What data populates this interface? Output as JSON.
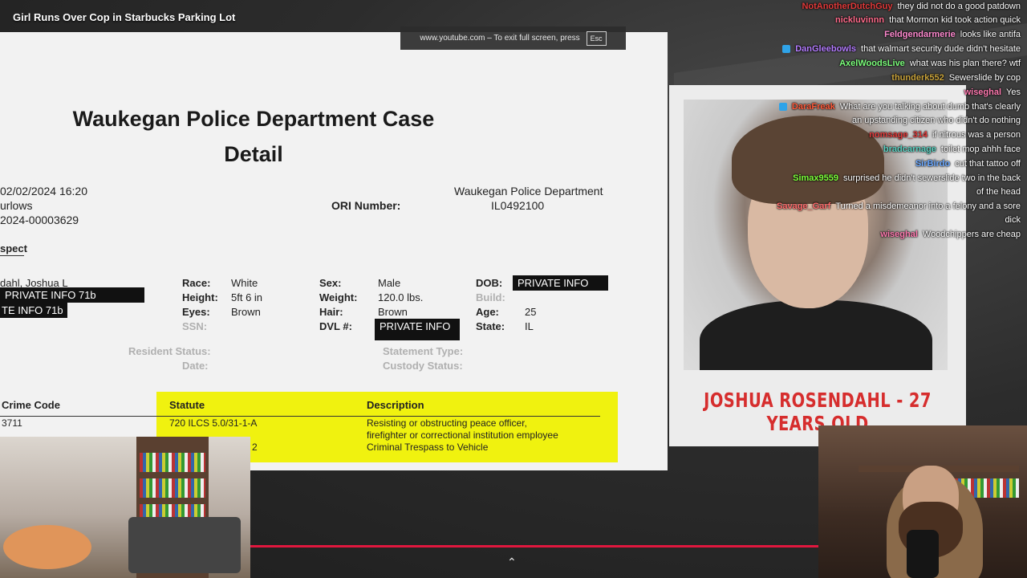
{
  "video": {
    "title": "Girl Runs Over Cop in Starbucks Parking Lot",
    "fullscreen_hint": "www.youtube.com – To exit full screen, press",
    "esc_key": "Esc",
    "progress_fraction": 1.0,
    "accent_color": "#e0173e"
  },
  "document": {
    "title_line1": "Waukegan Police Department Case",
    "title_line2": "Detail",
    "datetime": "02/02/2024 16:20",
    "officer": "urlows",
    "case_no": "2024-00003629",
    "ori_label": "ORI Number:",
    "dept_name": "Waukegan Police Department",
    "ori_number": "IL0492100",
    "section": "spect",
    "name": "dahl, Joshua L",
    "redact1": "PRIVATE INFO 71b",
    "redact2": "TE INFO 71b",
    "race_label": "Race:",
    "race": "White",
    "height_label": "Height:",
    "height": "5ft 6 in",
    "eyes_label": "Eyes:",
    "eyes": "Brown",
    "ssn_label": "SSN:",
    "sex_label": "Sex:",
    "sex": "Male",
    "weight_label": "Weight:",
    "weight": "120.0 lbs.",
    "hair_label": "Hair:",
    "hair": "Brown",
    "dvl_label": "DVL #:",
    "dvl": "PRIVATE INFO",
    "dob_label": "DOB:",
    "dob": "PRIVATE INFO",
    "build_label": "Build:",
    "age_label": "Age:",
    "age": "25",
    "state_label": "State:",
    "state": "IL",
    "resident_label": "Resident Status:",
    "date_label": "Date:",
    "statement_label": "Statement Type:",
    "custody_label": "Custody Status:",
    "crime_code_header": "Crime Code",
    "statute_header": "Statute",
    "description_header": "Description",
    "crime_code": "3711",
    "statute": "720 ILCS 5.0/31-1-A",
    "statute2_fragment": "2",
    "desc_line1": "Resisting or obstructing peace officer,",
    "desc_line2": "firefighter or correctional institution employee",
    "desc_line3": "Criminal Trespass to Vehicle"
  },
  "mugshot": {
    "caption": "JOSHUA ROSENDAHL - 27 YEARS OLD"
  },
  "chat": [
    {
      "user": "NotAnotherDutchGuy",
      "color": "#e23a3a",
      "text": "they did not do a good patdown",
      "badge": false
    },
    {
      "user": "nickluvinnn",
      "color": "#ff6a8a",
      "text": "that Mormon kid took action quick",
      "badge": false
    },
    {
      "user": "Feldgendarmerie",
      "color": "#ff8ad0",
      "text": "looks like antifa",
      "badge": false
    },
    {
      "user": "DanGleebowls",
      "color": "#b47cff",
      "text": "that walmart security dude didn't hesitate",
      "badge": true
    },
    {
      "user": "AxelWoodsLive",
      "color": "#7cff7c",
      "text": "what was his plan there? wtf",
      "badge": false
    },
    {
      "user": "thunderk552",
      "color": "#c8a23a",
      "text": "Sewerslide by cop",
      "badge": false
    },
    {
      "user": "wiseghal",
      "color": "#ff7ab0",
      "text": "Yes",
      "badge": false
    },
    {
      "user": "DaraFreak",
      "color": "#ff5a3a",
      "text": "What are you talking about dumb that's clearly",
      "badge": true
    },
    {
      "user": "",
      "color": "#ffffff",
      "text": "an upstanding citizen who didn't do nothing",
      "badge": false
    },
    {
      "user": "nomsage_314",
      "color": "#e23a3a",
      "text": "if nitrous was a person",
      "badge": false
    },
    {
      "user": "bradcarnage",
      "color": "#5ad0c0",
      "text": "toilet mop ahhh face",
      "badge": false
    },
    {
      "user": "SirBirdo",
      "color": "#6aa8ff",
      "text": "cut that tattoo off",
      "badge": false
    },
    {
      "user": "Simax9559",
      "color": "#7cff3a",
      "text": "surprised he didn't sewerslide two in the back",
      "badge": false
    },
    {
      "user": "",
      "color": "#ffffff",
      "text": "of the head",
      "badge": false
    },
    {
      "user": "Savage_Garf",
      "color": "#ff6a6a",
      "text": "Turned a misdemeanor into a felony and a sore",
      "badge": false
    },
    {
      "user": "",
      "color": "#ffffff",
      "text": "dick",
      "badge": false
    },
    {
      "user": "wiseghal",
      "color": "#ff7ab0",
      "text": "Woodchippers are cheap",
      "badge": false
    }
  ],
  "controls": {
    "chevron": "⌃"
  }
}
